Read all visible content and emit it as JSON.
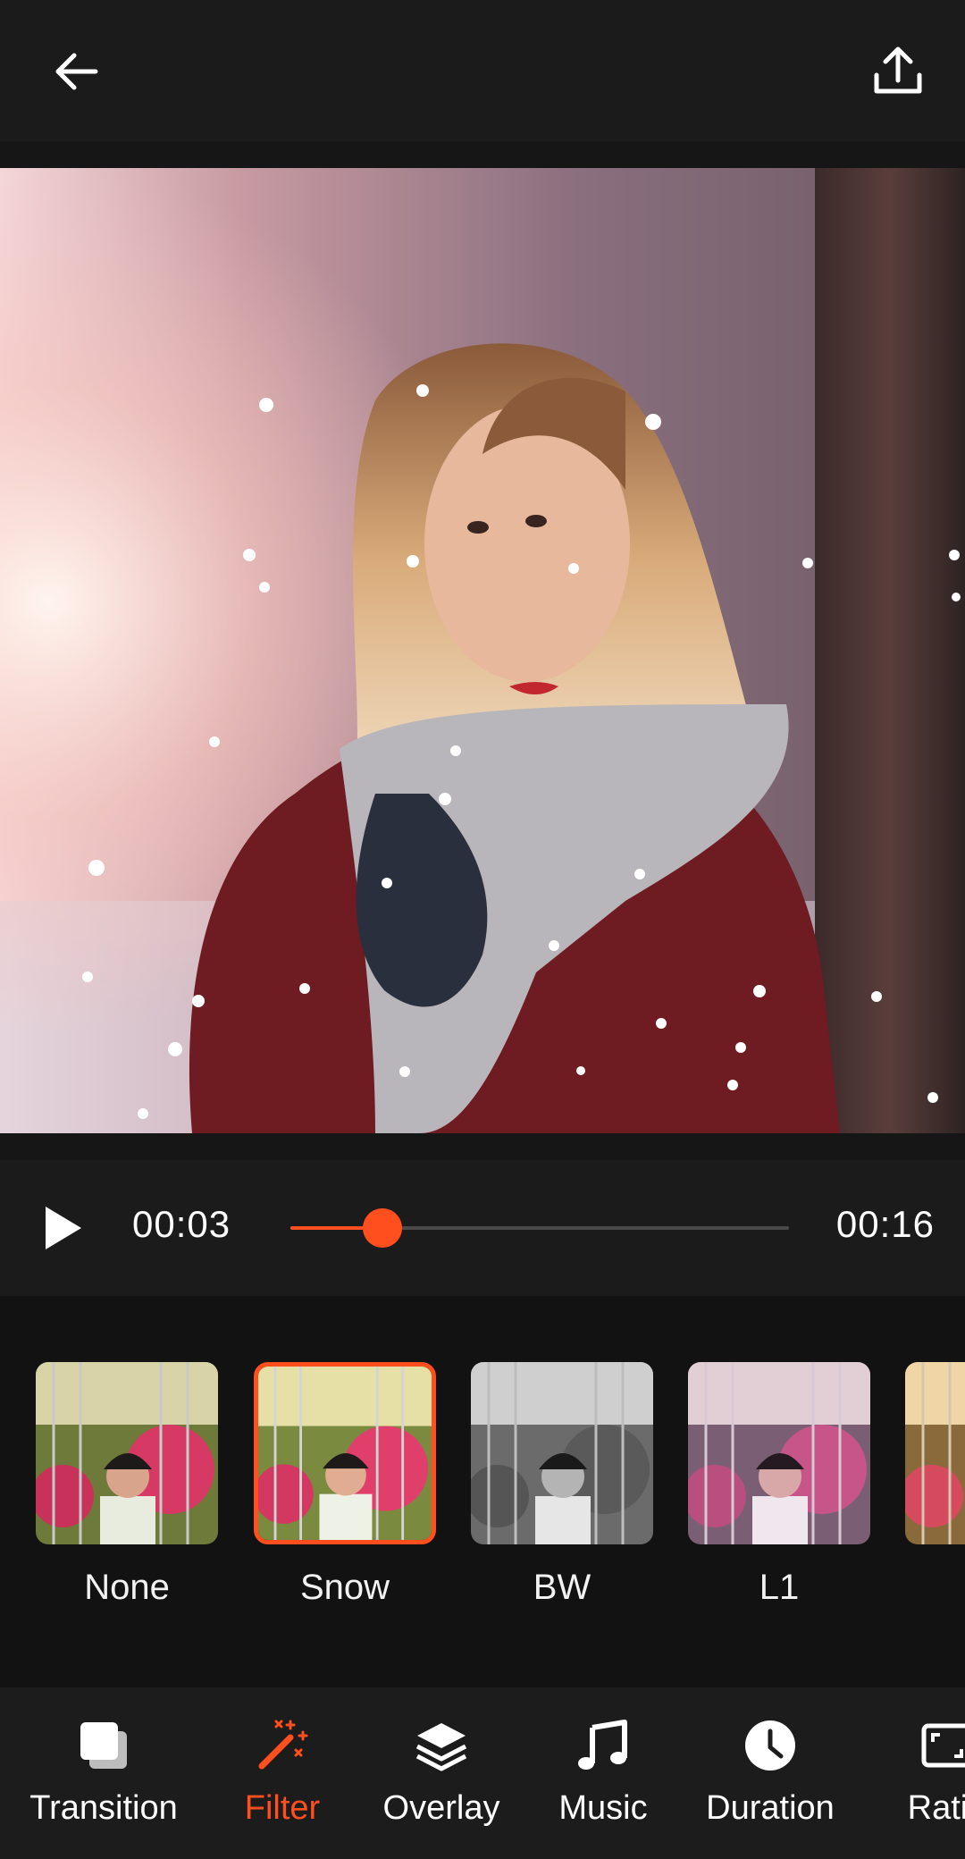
{
  "header": {
    "back_icon": "arrow-left-icon",
    "share_icon": "upload-icon"
  },
  "player": {
    "current_time": "00:03",
    "total_time": "00:16",
    "progress": 0.185,
    "play_icon": "play-icon"
  },
  "filters": {
    "selected": "Snow",
    "items": [
      {
        "label": "None"
      },
      {
        "label": "Snow"
      },
      {
        "label": "BW"
      },
      {
        "label": "L1"
      },
      {
        "label": ""
      }
    ]
  },
  "toolbar": {
    "active": "Filter",
    "items": [
      {
        "label": "Transition",
        "icon": "layers-square-icon"
      },
      {
        "label": "Filter",
        "icon": "magic-wand-icon"
      },
      {
        "label": "Overlay",
        "icon": "stack-icon"
      },
      {
        "label": "Music",
        "icon": "music-note-icon"
      },
      {
        "label": "Duration",
        "icon": "clock-icon"
      },
      {
        "label": "Ratio",
        "icon": "aspect-ratio-icon"
      }
    ]
  },
  "colors": {
    "accent": "#ff4f1e",
    "background": "#121212",
    "bar": "#1c1c1c"
  }
}
